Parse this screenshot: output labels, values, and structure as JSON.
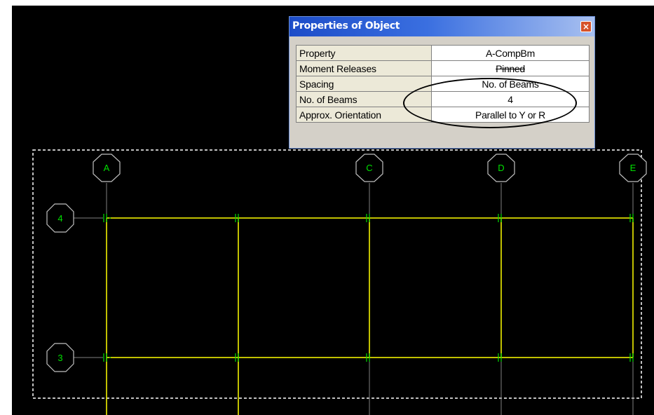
{
  "window": {
    "title": "Properties of Object",
    "close_glyph": "×"
  },
  "properties": [
    {
      "name": "Property",
      "value": "A-CompBm"
    },
    {
      "name": "Moment Releases",
      "value": "Pinned"
    },
    {
      "name": "Spacing",
      "value": "No. of Beams"
    },
    {
      "name": "No. of Beams",
      "value": "4"
    },
    {
      "name": "Approx. Orientation",
      "value": "Parallel to Y or R"
    }
  ],
  "grid": {
    "columns": [
      "A",
      "C",
      "D",
      "E"
    ],
    "rows": [
      "4",
      "3"
    ]
  },
  "colors": {
    "background": "#000000",
    "beam": "#ffff00",
    "grid_line": "#808080",
    "bubble_outline": "#c0c0c0",
    "label": "#00e000",
    "selection_box": "#ffffff",
    "title_bar": "#1c4cc8"
  }
}
